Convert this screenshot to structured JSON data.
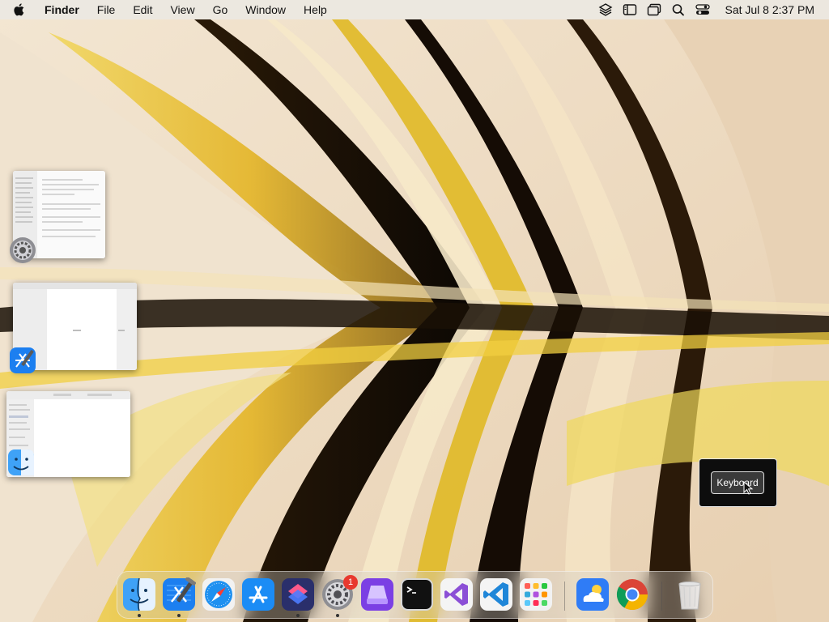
{
  "menubar": {
    "app_name": "Finder",
    "menus": [
      "File",
      "Edit",
      "View",
      "Go",
      "Window",
      "Help"
    ],
    "status_icons": [
      "layers-icon",
      "sidebar-icon",
      "windows-icon",
      "search-icon",
      "control-center-icon"
    ],
    "clock": "Sat Jul 8  2:37 PM"
  },
  "stage_manager": [
    {
      "app": "System Settings",
      "icon": "gear-icon"
    },
    {
      "app": "Xcode",
      "icon": "xcode-icon"
    },
    {
      "app": "Finder",
      "icon": "finder-icon"
    }
  ],
  "hud": {
    "button_label": "Keyboard"
  },
  "dock": {
    "items": [
      {
        "name": "Finder",
        "running": true
      },
      {
        "name": "Xcode",
        "running": true
      },
      {
        "name": "Safari",
        "running": false
      },
      {
        "name": "App Store",
        "running": false
      },
      {
        "name": "Shortcuts",
        "running": true
      },
      {
        "name": "System Settings",
        "running": true,
        "badge": "1"
      },
      {
        "name": "Stack",
        "running": false
      },
      {
        "name": "Terminal",
        "running": false
      },
      {
        "name": "Visual Studio",
        "running": false
      },
      {
        "name": "Visual Studio Code",
        "running": false
      },
      {
        "name": "Launchpad",
        "running": false
      },
      {
        "name": "Weather",
        "running": false
      },
      {
        "name": "Google Chrome",
        "running": false
      },
      {
        "name": "Trash",
        "running": false
      }
    ]
  },
  "colors": {
    "badge": "#e8392f",
    "accent": "#2f7cf6"
  }
}
